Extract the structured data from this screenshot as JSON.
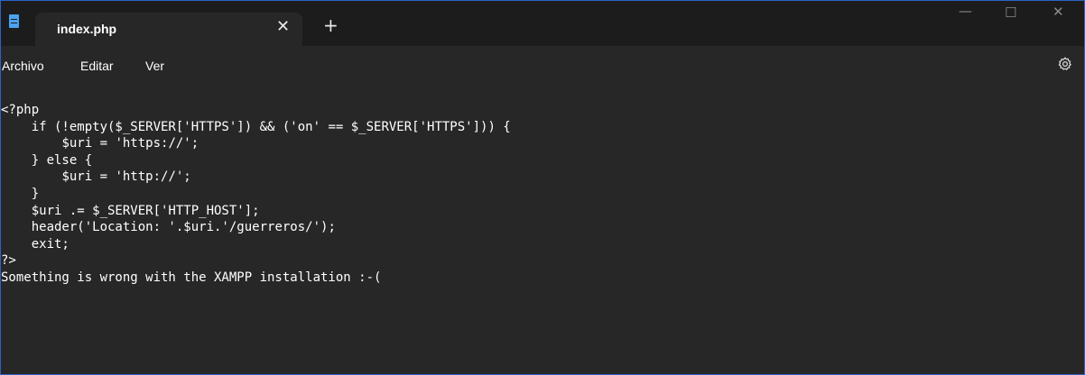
{
  "window": {
    "tab": {
      "title": "index.php",
      "close_glyph": "✕"
    },
    "new_tab_glyph": "+",
    "controls": {
      "minimize": "—",
      "maximize": "☐",
      "close": "✕"
    }
  },
  "menu": {
    "items": [
      "Archivo",
      "Editar",
      "Ver"
    ],
    "settings_icon": "gear-icon"
  },
  "editor": {
    "lines": [
      "<?php",
      "\tif (!empty($_SERVER['HTTPS']) && ('on' == $_SERVER['HTTPS'])) {",
      "\t\t$uri = 'https://';",
      "\t} else {",
      "\t\t$uri = 'http://';",
      "\t}",
      "\t$uri .= $_SERVER['HTTP_HOST'];",
      "\theader('Location: '.$uri.'/guerreros/');",
      "\texit;",
      "?>",
      "Something is wrong with the XAMPP installation :-("
    ]
  },
  "colors": {
    "titlebar": "#1c1c1c",
    "editor_bg": "#272727",
    "accent_border": "#2b63c6",
    "app_icon": "#4aa3f0"
  }
}
